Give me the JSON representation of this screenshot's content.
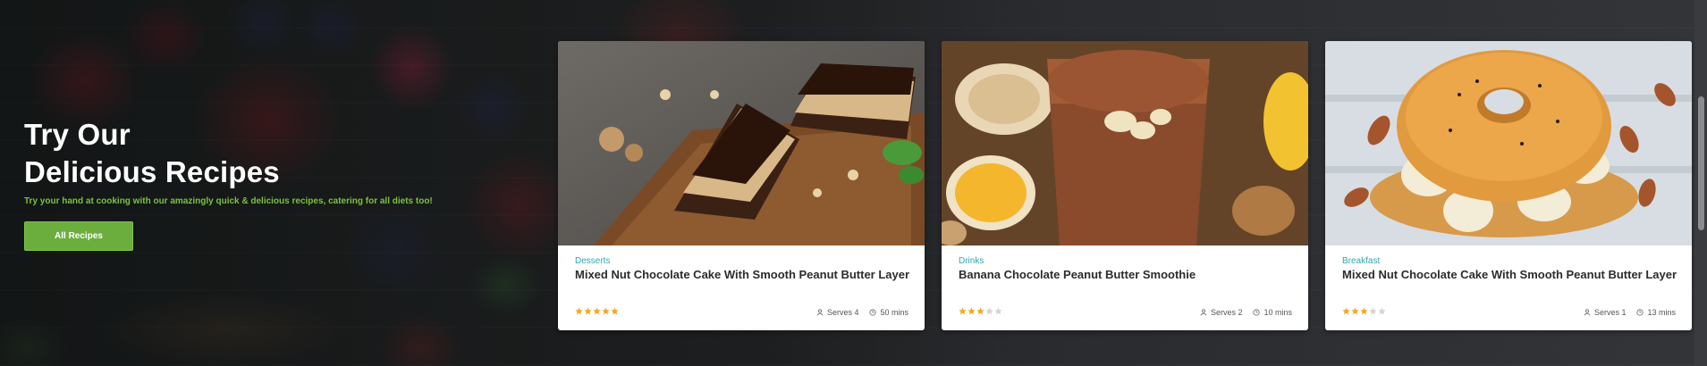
{
  "hero": {
    "title_line1": "Try Our",
    "title_line2": "Delicious Recipes",
    "subtitle": "Try your hand at cooking with our amazingly quick & delicious recipes, catering for all diets too!",
    "button_label": "All Recipes",
    "accent_color": "#6cae3e"
  },
  "cards": [
    {
      "category": "Desserts",
      "title": "Mixed Nut Chocolate Cake With Smooth Peanut Butter Layer",
      "rating": 5,
      "rating_max": 5,
      "serves": "Serves 4",
      "time": "50 mins"
    },
    {
      "category": "Drinks",
      "title": "Banana Chocolate Peanut Butter Smoothie",
      "rating": 3,
      "rating_max": 5,
      "serves": "Serves 2",
      "time": "10 mins"
    },
    {
      "category": "Breakfast",
      "title": "Mixed Nut Chocolate Cake With Smooth Peanut Butter Layer",
      "rating": 3,
      "rating_max": 5,
      "serves": "Serves 1",
      "time": "13 mins"
    }
  ],
  "colors": {
    "category": "#2aa9b4",
    "star_filled": "#f5a623",
    "star_empty": "#d3d3d3"
  },
  "icons": {
    "serves": "person-icon",
    "time": "clock-icon",
    "rating": "star-icon"
  }
}
